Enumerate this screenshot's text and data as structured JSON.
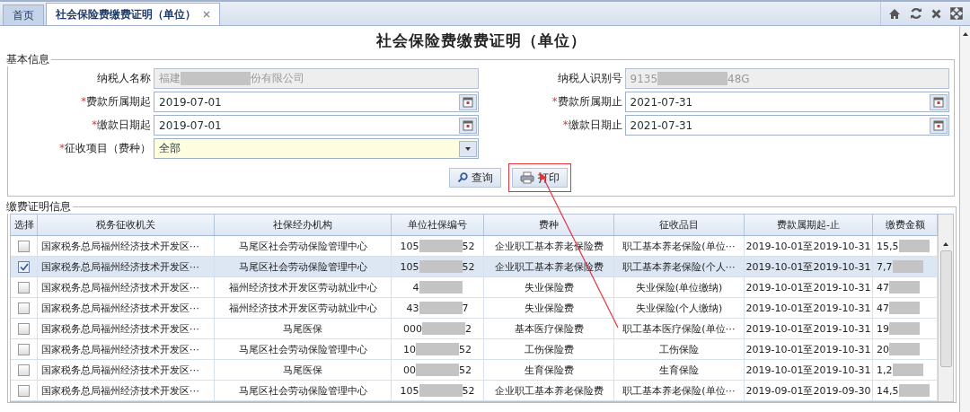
{
  "tabs": [
    {
      "label": "首页",
      "selected": false,
      "closable": false
    },
    {
      "label": "社会保险费缴费证明（单位）",
      "selected": true,
      "closable": true
    }
  ],
  "page_title": "社会保险费缴费证明（单位）",
  "basic_info": {
    "legend": "基本信息",
    "fields": [
      {
        "label": "纳税人名称",
        "kind": "readonly",
        "value": [
          "福建",
          "份有限公司"
        ]
      },
      {
        "label": "纳税人识别号",
        "kind": "readonly",
        "value": [
          "9135",
          "48G"
        ]
      },
      {
        "required_mark": "*",
        "label": "费款所属期起",
        "kind": "date",
        "value": [
          "2019-07-01"
        ]
      },
      {
        "required_mark": "*",
        "label": "费款所属期止",
        "kind": "date",
        "value": [
          "2021-07-31"
        ]
      },
      {
        "required_mark": "*",
        "label": "缴款日期起",
        "kind": "date",
        "value": [
          "2019-07-01"
        ]
      },
      {
        "required_mark": "*",
        "label": "缴款日期止",
        "kind": "date",
        "value": [
          "2021-07-31"
        ]
      },
      {
        "required_mark": "*",
        "label": "征收项目（费种）",
        "kind": "select",
        "value": [
          "全部"
        ]
      }
    ],
    "buttons": [
      {
        "label": "查询",
        "kind": "search",
        "highlighted": false
      },
      {
        "label": "打印",
        "kind": "print",
        "highlighted": true
      }
    ]
  },
  "certificate_info": {
    "legend": "缴费证明信息",
    "columns": [
      "选择",
      "税务征收机关",
      "社保经办机构",
      "单位社保编号",
      "费种",
      "征收品目",
      "费款属期起-止",
      "缴费金额"
    ],
    "rows": [
      {
        "checked": false,
        "selected": false,
        "cells": [
          "",
          "国家税务总局福州经济技术开发区⋯",
          "马尾区社会劳动保险管理中心",
          [
            "105",
            "52"
          ],
          "企业职工基本养老保险费",
          "职工基本养老保险(单位⋯",
          "2019-10-01至2019-10-31",
          [
            "15,5"
          ]
        ]
      },
      {
        "checked": true,
        "selected": true,
        "cells": [
          "",
          "国家税务总局福州经济技术开发区⋯",
          "马尾区社会劳动保险管理中心",
          [
            "105",
            "52"
          ],
          "企业职工基本养老保险费",
          "职工基本养老保险(个人⋯",
          "2019-10-01至2019-10-31",
          [
            "7,7"
          ]
        ]
      },
      {
        "checked": false,
        "selected": false,
        "cells": [
          "",
          "国家税务总局福州经济技术开发区⋯",
          "福州经济技术开发区劳动就业中心",
          [
            "4",
            ""
          ],
          "失业保险费",
          "失业保险(单位缴纳)",
          "2019-10-01至2019-10-31",
          [
            "47"
          ]
        ]
      },
      {
        "checked": false,
        "selected": false,
        "cells": [
          "",
          "国家税务总局福州经济技术开发区⋯",
          "福州经济技术开发区劳动就业中心",
          [
            "43",
            "7"
          ],
          "失业保险费",
          "失业保险(个人缴纳)",
          "2019-10-01至2019-10-31",
          [
            "47"
          ]
        ]
      },
      {
        "checked": false,
        "selected": false,
        "cells": [
          "",
          "国家税务总局福州经济技术开发区⋯",
          "马尾医保",
          [
            "000",
            "2"
          ],
          "基本医疗保险费",
          "职工基本医疗保险(单位⋯",
          "2019-10-01至2019-10-31",
          [
            "19"
          ]
        ]
      },
      {
        "checked": false,
        "selected": false,
        "cells": [
          "",
          "国家税务总局福州经济技术开发区⋯",
          "马尾区社会劳动保险管理中心",
          [
            "10",
            "52"
          ],
          "工伤保险费",
          "工伤保险",
          "2019-10-01至2019-10-31",
          [
            "20"
          ]
        ]
      },
      {
        "checked": false,
        "selected": false,
        "cells": [
          "",
          "国家税务总局福州经济技术开发区⋯",
          "马尾医保",
          [
            "00",
            "52"
          ],
          "生育保险费",
          "生育保险",
          "2019-10-01至2019-10-31",
          [
            "1,2"
          ]
        ]
      },
      {
        "checked": false,
        "selected": false,
        "cells": [
          "",
          "国家税务总局福州经济技术开发区⋯",
          "马尾区社会劳动保险管理中心",
          [
            "105",
            "52"
          ],
          "企业职工基本养老保险费",
          "职工基本养老保险(单位⋯",
          "2019-09-01至2019-09-30",
          [
            "14,5"
          ]
        ]
      }
    ]
  }
}
